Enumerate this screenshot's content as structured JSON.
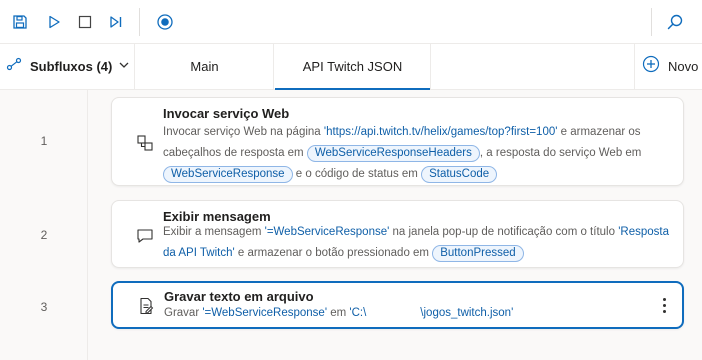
{
  "toolbar": {
    "buttons": [
      "save-icon",
      "run-icon",
      "stop-icon",
      "run-next-action-icon",
      "record-icon",
      "search-icon"
    ]
  },
  "tabbar": {
    "subflows_label": "Subfluxos (4)",
    "tabs": [
      {
        "label": "Main"
      },
      {
        "label": "API Twitch JSON"
      }
    ],
    "new_label": "Novo"
  },
  "actions": [
    {
      "line": "1",
      "icon": "web-service-icon",
      "title": "Invocar serviço Web",
      "desc": {
        "t1": "Invocar serviço Web na página ",
        "s1": "'https://api.twitch.tv/helix/games/top?first=100'",
        "t2": " e armazenar os cabeçalhos de resposta em ",
        "v1": "WebServiceResponseHeaders",
        "t3": ", a resposta do serviço Web em ",
        "v2": "WebServiceResponse",
        "t4": " e o código de status em ",
        "v3": "StatusCode"
      }
    },
    {
      "line": "2",
      "icon": "message-icon",
      "title": "Exibir mensagem",
      "desc": {
        "t1": "Exibir a mensagem ",
        "s1": "'=WebServiceResponse'",
        "t2": " na janela pop-up de notificação com o título ",
        "s2": "'Resposta da API Twitch'",
        "t3": " e armazenar o botão pressionado em ",
        "v1": "ButtonPressed"
      }
    },
    {
      "line": "3",
      "icon": "write-file-icon",
      "title": "Gravar texto em arquivo",
      "desc": {
        "t1": "Gravar ",
        "s1": "'=WebServiceResponse'",
        "t2": " em ",
        "s2": "'C:\\",
        "s3": "\\jogos_twitch.json'"
      }
    }
  ],
  "colors": {
    "accent": "#0f6cbd",
    "string_text": "#0f5fa8",
    "variable_pill_bg": "#eef5fd",
    "variable_pill_border": "#8fb6e6"
  }
}
